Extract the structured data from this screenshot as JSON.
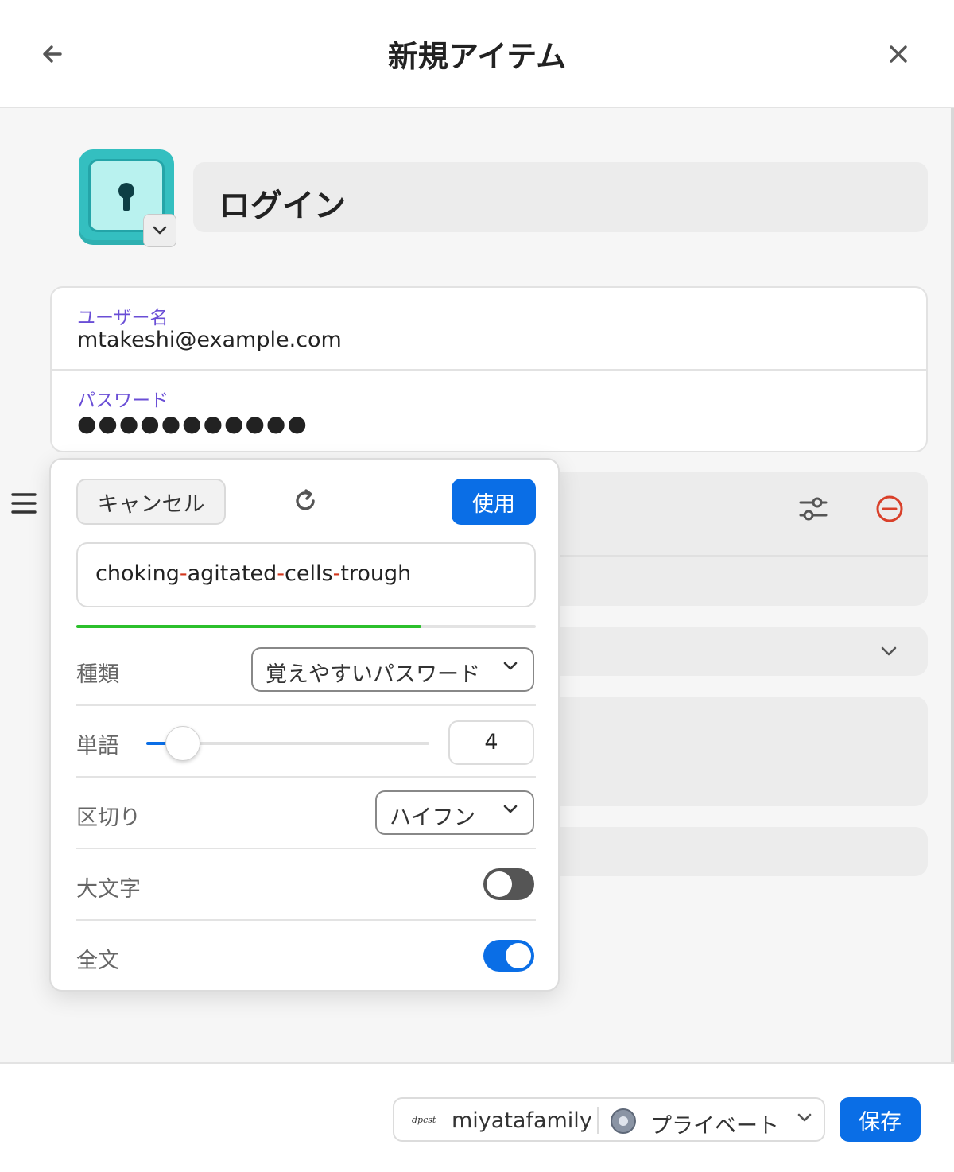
{
  "header": {
    "title": "新規アイテム"
  },
  "item": {
    "type_title": "ログイン"
  },
  "credentials": {
    "username_label": "ユーザー名",
    "username_value": "mtakeshi@example.com",
    "password_label": "パスワード",
    "password_masked": "●●●●●●●●●●●"
  },
  "generator": {
    "cancel_label": "キャンセル",
    "use_label": "使用",
    "password_parts": [
      "choking",
      "agitated",
      "cells",
      "trough"
    ],
    "separator_char": "-",
    "strength_percent": 75,
    "strength_color": "#2bc02b",
    "type_label": "種類",
    "type_value": "覚えやすいパスワード",
    "words_label": "単語",
    "words_value": "4",
    "separator_label": "区切り",
    "separator_value": "ハイフン",
    "uppercase_label": "大文字",
    "uppercase_on": false,
    "fullwords_label": "全文",
    "fullwords_on": true
  },
  "footer": {
    "vault_owner": "miyatafamily",
    "vault_name": "プライベート",
    "save_label": "保存"
  },
  "colors": {
    "accent": "#0a6ee6",
    "field_label": "#6a4ed6",
    "remove": "#d9402a",
    "password_separator": "#d2361c"
  }
}
